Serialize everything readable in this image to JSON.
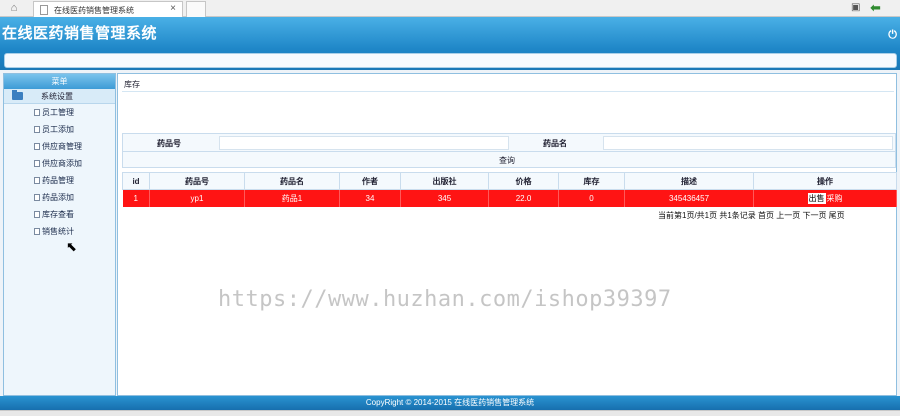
{
  "browser": {
    "tab_title": "在线医药销售管理系统",
    "tab_close": "×"
  },
  "header": {
    "app_title": "在线医药销售管理系统",
    "power_icon": "⏻"
  },
  "sidebar": {
    "menu_title": "菜单",
    "section_label": "系统设置",
    "items": [
      {
        "label": "员工管理"
      },
      {
        "label": "员工添加"
      },
      {
        "label": "供应商管理"
      },
      {
        "label": "供应商添加"
      },
      {
        "label": "药品管理"
      },
      {
        "label": "药品添加"
      },
      {
        "label": "库存查看"
      },
      {
        "label": "销售统计"
      }
    ]
  },
  "main": {
    "breadcrumb": "库存",
    "search": {
      "label_code": "药品号",
      "label_name": "药品名",
      "query_button": "查询"
    },
    "table": {
      "headers": [
        "id",
        "药品号",
        "药品名",
        "作者",
        "出版社",
        "价格",
        "库存",
        "描述",
        "操作"
      ],
      "rows": [
        {
          "id": "1",
          "code": "yp1",
          "name": "药品1",
          "author": "34",
          "publisher": "345",
          "price": "22.0",
          "stock": "0",
          "desc": "345436457",
          "action_primary": "出售",
          "action_secondary": "采购"
        }
      ]
    },
    "pager": "当前第1页/共1页 共1条记录 首页 上一页 下一页 尾页"
  },
  "watermark": "https://www.huzhan.com/ishop39397",
  "footer": {
    "copyright": "CopyRight © 2014-2015 在线医药销售管理系统"
  },
  "colors": {
    "header_blue": "#1f87c8",
    "row_highlight": "#ff1414"
  }
}
